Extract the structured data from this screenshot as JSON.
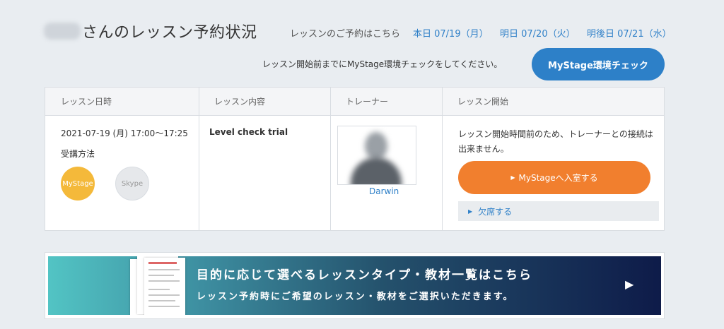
{
  "header": {
    "title": "さんのレッスン予約状況",
    "reserve_label": "レッスンのご予約はこちら",
    "dates": {
      "today": "本日 07/19（月）",
      "tomorrow": "明日 07/20（火）",
      "day_after": "明後日 07/21（水）"
    },
    "check_note": "レッスン開始前までにMyStage環境チェックをしてください。",
    "check_button": "MyStage環境チェック"
  },
  "table": {
    "headers": [
      "レッスン日時",
      "レッスン内容",
      "トレーナー",
      "レッスン開始"
    ],
    "row": {
      "datetime": "2021-07-19 (月) 17:00〜17:25",
      "method_label": "受講方法",
      "methods": [
        "MyStage",
        "Skype"
      ],
      "content": "Level check trial",
      "trainer_name": "Darwin",
      "start_note": "レッスン開始時間前のため、トレーナーとの接続は出来ません。",
      "enter_button": "MyStageへ入室する",
      "absent_button": "欠席する"
    }
  },
  "banner": {
    "title": "目的に応じて選べるレッスンタイプ・教材一覧はこちら",
    "subtitle": "レッスン予約時にご希望のレッスン・教材をご選択いただきます。"
  },
  "icons": {
    "play": "▶"
  }
}
